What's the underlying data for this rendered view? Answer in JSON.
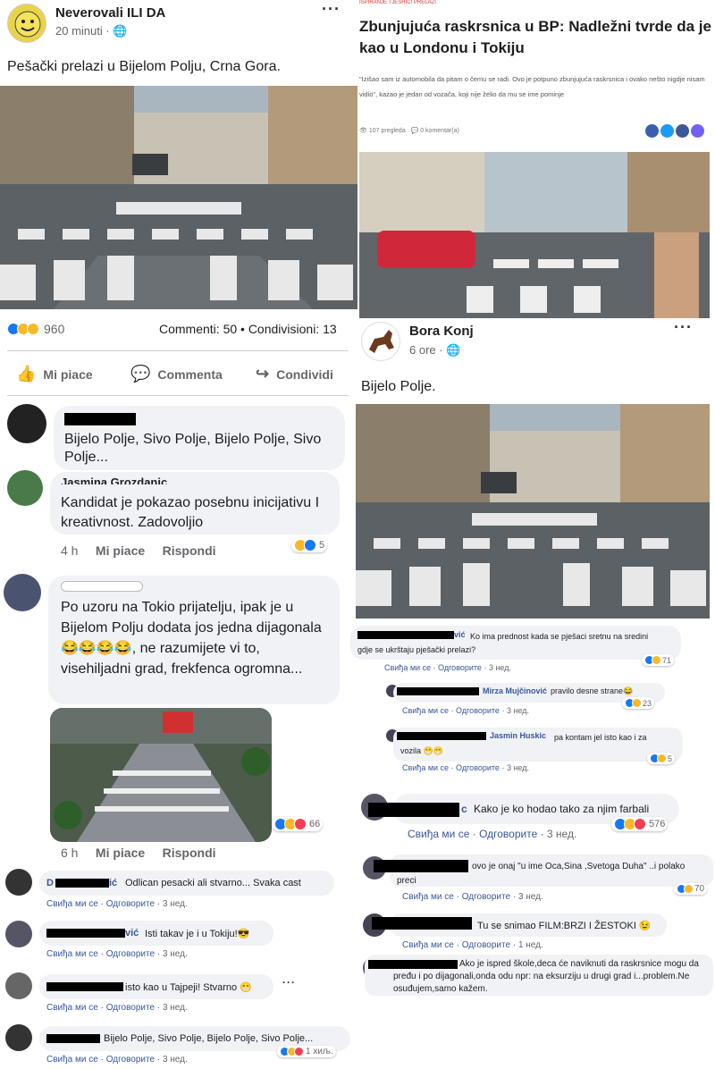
{
  "post1": {
    "page_name": "Neverovali ILI DA",
    "time": "20 minuti",
    "text": "Pešački prelazi u Bijelom Polju, Crna Gora.",
    "reaction_count": "960",
    "stats": "Commenti: 50 • Condivisioni: 13",
    "actions": [
      "Mi piace",
      "Commenta",
      "Condividi"
    ],
    "comments": [
      {
        "text": "Bijelo Polje, Sivo Polje, Bijelo Polje, Sivo Polje..."
      },
      {
        "author": "Jasmina Grozdanic",
        "text": "Kandidat je pokazao posebnu inicijativu I kreativnost. Zadovoljio",
        "time": "4 h",
        "like": "Mi piace",
        "reply": "Rispondi",
        "reactions": "5"
      },
      {
        "text": "Po uzoru na Tokio prijatelju, ipak je u Bijelom Polju dodata jos jedna dijagonala 😂😂😂😂, ne razumijete vi to, visehiljadni grad, frekfenca ogromna...",
        "time": "6 h",
        "like": "Mi piace",
        "reply": "Rispondi",
        "reactions": "66"
      }
    ]
  },
  "post1_cyrillic_comments": [
    {
      "author_suffix": "D",
      "author_end": "ić",
      "text": "Odlican pesacki ali stvarno... Svaka cast",
      "like": "Свиђа ми се",
      "reply": "Одговорите",
      "time": "3 нед."
    },
    {
      "author_end": "vić",
      "text": "Isti takav je i u Tokiju!😎",
      "like": "Свиђа ми се",
      "reply": "Одговорите",
      "time": "3 нед."
    },
    {
      "text": "isto kao u Tajpeji! Stvarno 😁",
      "like": "Свиђа ми се",
      "reply": "Одговорите",
      "time": "3 нед."
    },
    {
      "text": "Bijelo Polje, Sivo Polje, Bijelo Polje, Sivo Polje...",
      "like": "Свиђа ми се",
      "reply": "Одговорите",
      "time": "3 нед.",
      "reactions": "1 хиљ."
    }
  ],
  "article": {
    "tag": "ISPIRANJE TJESRICI PRELAZI",
    "title": "Zbunjujuća raskrsnica u BP: Nadležni tvrde da je kao u Londonu i Tokiju",
    "lead": "\"Izišao sam iz automobila da pitam o čemu se radi. Ovo je potpuno zbunjujuća raskrsnica i ovako nešto nigdje nisam vidio\", kazao je jedan od vozača, koji nije želio da mu se ime pominje",
    "views": "107 pregleda",
    "comments": "0 komentar(a)"
  },
  "post2": {
    "author": "Bora Konj",
    "time": "6 ore",
    "text": "Bijelo Polje.",
    "comments": [
      {
        "author_end": "vić",
        "text": "Ko ima prednost kada se pješaci sretnu na sredini gdje se ukrštaju pješački prelazi?",
        "like": "Свиђа ми се",
        "reply": "Одговорите",
        "time": "3 нед.",
        "reactions": "71"
      },
      {
        "author": "Mirza Mujčinović",
        "text": "pravilo desne strane😂",
        "like": "Свиђа ми се",
        "reply": "Одговорите",
        "time": "3 нед.",
        "reactions": "23"
      },
      {
        "author": "Jasmin Huskic",
        "text": "pa kontam jel isto kao i za vozila 😁😁",
        "like": "Свиђа ми се",
        "reply": "Одговорите",
        "time": "3 нед.",
        "reactions": "5"
      },
      {
        "author_end": "c",
        "text": "Kako je ko hodao tako za njim farbali",
        "like": "Свиђа ми се",
        "reply": "Одговорите",
        "time": "3 нед.",
        "reactions": "576"
      },
      {
        "text": "ovo je onaj \"u ime Oca,Sina ,Svetoga Duha\" ..i polako preci",
        "like": "Свиђа ми се",
        "reply": "Одговорите",
        "time": "3 нед.",
        "reactions": "70"
      },
      {
        "text": "Tu se snimao FILM:BRZI I ŽESTOKI 😉",
        "like": "Свиђа ми се",
        "reply": "Одговорите",
        "time": "1 нед."
      },
      {
        "text": "Ako je ispred škole,deca će naviknuti da raskrsnice mogu da pređu i po dijagonali,onda odu npr: na eksurziju u drugi grad i...problem.Ne osuđujem,samo kažem."
      }
    ]
  }
}
